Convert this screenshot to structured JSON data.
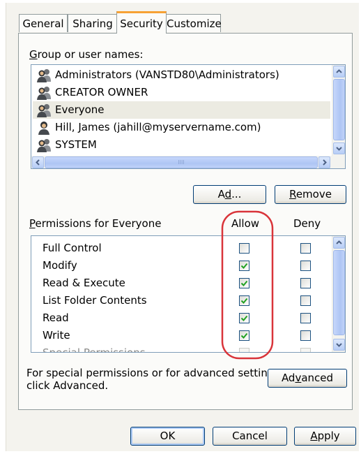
{
  "tabs": [
    {
      "label": "General"
    },
    {
      "label": "Sharing"
    },
    {
      "label": "Security",
      "active": true
    },
    {
      "label": "Customize"
    }
  ],
  "group_section": {
    "label_access": "G",
    "label_rest": "roup or user names:",
    "users": [
      {
        "name": "Administrators (VANSTD80\\Administrators)",
        "icon": "group-icon"
      },
      {
        "name": "CREATOR OWNER",
        "icon": "group-icon"
      },
      {
        "name": "Everyone",
        "icon": "group-icon",
        "selected": true
      },
      {
        "name": "Hill, James (jahill@myservername.com)",
        "icon": "user-icon"
      },
      {
        "name": "SYSTEM",
        "icon": "group-icon"
      }
    ],
    "hscroll_grip": "IIII"
  },
  "buttons": {
    "add_pre": "A",
    "add_access": "d",
    "add_post": "d...",
    "remove_access": "R",
    "remove_rest": "emove",
    "advanced_pre": "Ad",
    "advanced_access": "v",
    "advanced_post": "anced",
    "ok": "OK",
    "cancel": "Cancel",
    "apply_access": "A",
    "apply_rest": "pply"
  },
  "permissions": {
    "label_access": "P",
    "label_rest": "ermissions for Everyone",
    "allow_header": "Allow",
    "deny_header": "Deny",
    "rows": [
      {
        "name": "Full Control",
        "allow": false,
        "deny": false
      },
      {
        "name": "Modify",
        "allow": true,
        "deny": false
      },
      {
        "name": "Read & Execute",
        "allow": true,
        "deny": false
      },
      {
        "name": "List Folder Contents",
        "allow": true,
        "deny": false
      },
      {
        "name": "Read",
        "allow": true,
        "deny": false
      },
      {
        "name": "Write",
        "allow": true,
        "deny": false
      },
      {
        "name": "Special Permissions",
        "allow": false,
        "deny": false,
        "partially_visible": true
      }
    ]
  },
  "advanced_note": {
    "line1": "For special permissions or for advanced settings,",
    "line2": "click Advanced."
  },
  "colors": {
    "highlight_circle": "#d9343a",
    "checkmark": "#21a121",
    "active_tab_accent": "#f7a235",
    "scroll_blue": "#b7cdf6"
  }
}
